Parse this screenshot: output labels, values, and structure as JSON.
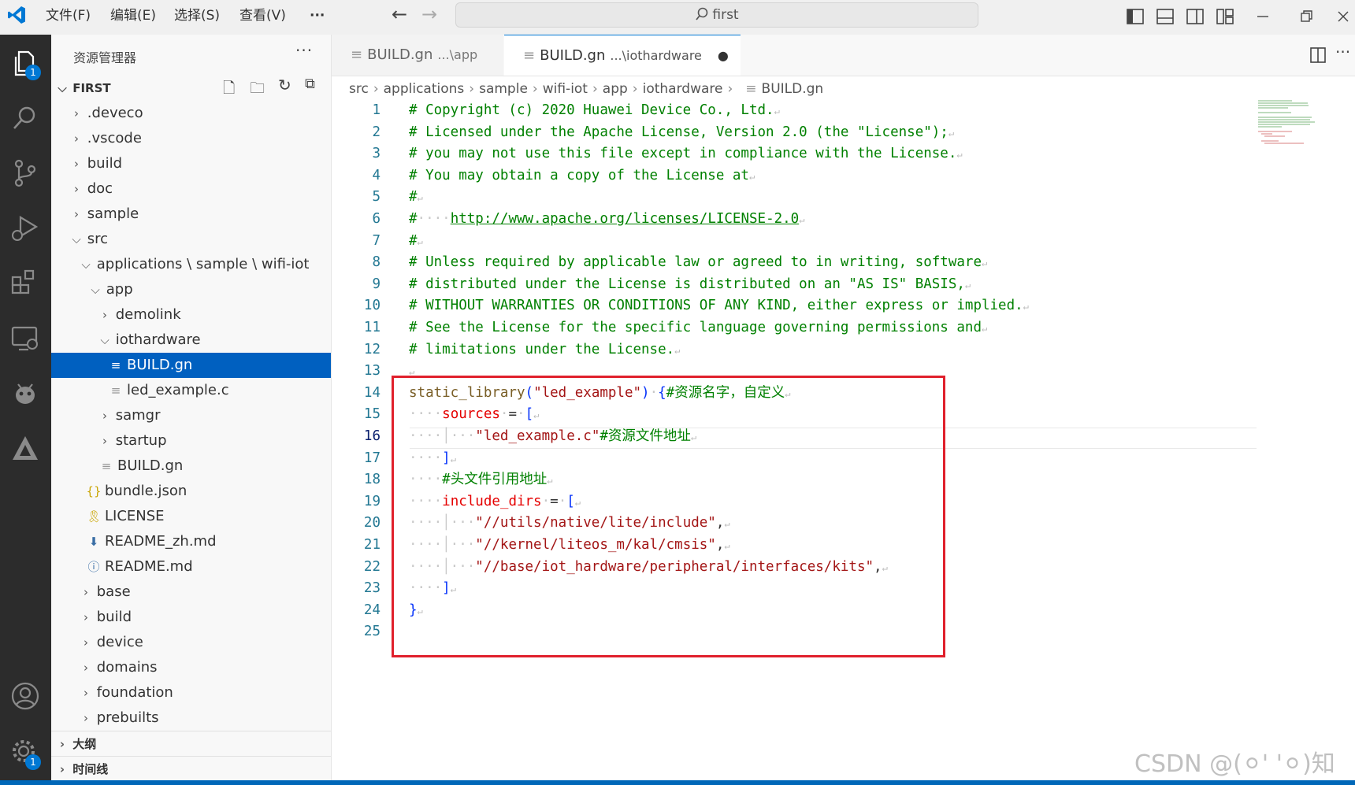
{
  "menu": {
    "file": "文件(F)",
    "edit": "编辑(E)",
    "select": "选择(S)",
    "view": "查看(V)",
    "more": "···"
  },
  "search": {
    "text": "first"
  },
  "activity": {
    "explorer_badge": "1",
    "settings_badge": "1"
  },
  "sidebar": {
    "title": "资源管理器",
    "more": "···",
    "workspace": "FIRST",
    "tree": [
      {
        "label": ".deveco"
      },
      {
        "label": ".vscode"
      },
      {
        "label": "build"
      },
      {
        "label": "doc"
      },
      {
        "label": "sample"
      },
      {
        "label": "src"
      },
      {
        "label": "applications \\ sample \\ wifi-iot"
      },
      {
        "label": "app"
      },
      {
        "label": "demolink"
      },
      {
        "label": "iothardware"
      },
      {
        "label": "BUILD.gn"
      },
      {
        "label": "led_example.c"
      },
      {
        "label": "samgr"
      },
      {
        "label": "startup"
      },
      {
        "label": "BUILD.gn"
      },
      {
        "label": "bundle.json"
      },
      {
        "label": "LICENSE"
      },
      {
        "label": "README_zh.md"
      },
      {
        "label": "README.md"
      },
      {
        "label": "base"
      },
      {
        "label": "build"
      },
      {
        "label": "device"
      },
      {
        "label": "domains"
      },
      {
        "label": "foundation"
      },
      {
        "label": "prebuilts"
      }
    ],
    "outline": "大纲",
    "timeline": "时间线"
  },
  "tabs": [
    {
      "name": "BUILD.gn",
      "desc": "...\\app"
    },
    {
      "name": "BUILD.gn",
      "desc": "...\\iothardware",
      "dirty": "●"
    }
  ],
  "breadcrumb": [
    "src",
    "applications",
    "sample",
    "wifi-iot",
    "app",
    "iothardware",
    "BUILD.gn"
  ],
  "code": {
    "line_numbers": [
      "1",
      "2",
      "3",
      "4",
      "5",
      "6",
      "7",
      "8",
      "9",
      "10",
      "11",
      "12",
      "13",
      "14",
      "15",
      "16",
      "17",
      "18",
      "19",
      "20",
      "21",
      "22",
      "23",
      "24",
      "25"
    ],
    "l1": "# Copyright (c) 2020 Huawei Device Co., Ltd.",
    "l2": "# Licensed under the Apache License, Version 2.0 (the \"License\");",
    "l3": "# you may not use this file except in compliance with the License.",
    "l4": "# You may obtain a copy of the License at",
    "l5": "#",
    "l6_hash": "#",
    "l6_url": "http://www.apache.org/licenses/LICENSE-2.0",
    "l7": "#",
    "l8": "# Unless required by applicable law or agreed to in writing, software",
    "l9": "# distributed under the License is distributed on an \"AS IS\" BASIS,",
    "l10": "# WITHOUT WARRANTIES OR CONDITIONS OF ANY KIND, either express or implied.",
    "l11": "# See the License for the specific language governing permissions and",
    "l12": "# limitations under the License.",
    "l14_fn": "static_library",
    "l14_arg": "\"led_example\"",
    "l14_cmt": "#资源名字，自定义",
    "l15_kw": "sources",
    "l16_str": "\"led_example.c\"",
    "l16_cmt": "#资源文件地址",
    "l18_cmt": "#头文件引用地址",
    "l19_kw": "include_dirs",
    "l20_str": "\"//utils/native/lite/include\"",
    "l21_str": "\"//kernel/liteos_m/kal/cmsis\"",
    "l22_str": "\"//base/iot_hardware/peripheral/interfaces/kits\""
  },
  "watermark": "CSDN @(⚪' '⚪)知",
  "colors": {
    "accent": "#0060c0",
    "highlight_box": "#e0202c",
    "statusbar": "#0067b8"
  }
}
